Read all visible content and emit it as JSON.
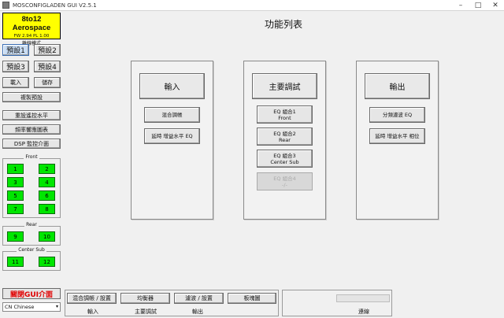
{
  "window": {
    "title": "MOSCONFIGLADEN GUI V2.5.1",
    "minimize": "–",
    "maximize": "□",
    "close": "✕"
  },
  "brand": {
    "name": "8to12 Aerospace",
    "fw": "FW 2.94   PL 1.00",
    "mode": "離線模式",
    "bg": "#ffff00"
  },
  "presets": [
    "預設1",
    "預設2",
    "預設3",
    "預設4"
  ],
  "left_buttons": {
    "import": "載入",
    "save": "儲存",
    "copy_preset": "複製預設",
    "input_level": "重設遙控水平",
    "freq_response": "頻率響應圖表",
    "dsp_monitor": "DSP 監控介面"
  },
  "groups": {
    "front": {
      "label": "Front",
      "channels": [
        "1",
        "2",
        "3",
        "4",
        "5",
        "6",
        "7",
        "8"
      ]
    },
    "rear": {
      "label": "Rear",
      "channels": [
        "9",
        "10"
      ]
    },
    "center_sub": {
      "label": "Center Sub",
      "channels": [
        "11",
        "12"
      ]
    }
  },
  "close_gui": "關閉GUI介面",
  "language": {
    "value": "CN Chinese",
    "arrow": "▾"
  },
  "main": {
    "title": "功能列表",
    "columns": [
      {
        "header": "輸入",
        "buttons": [
          "混合調帳",
          "延時 增益水平 EQ"
        ]
      },
      {
        "header": "主要調試",
        "buttons": [
          "EQ 組合1\nFront",
          "EQ 組合2\nRear",
          "EQ 組合3\nCenter Sub",
          "EQ 組合4\n-/-"
        ]
      },
      {
        "header": "輸出",
        "buttons": [
          "分頻濾波 EQ",
          "延時 增益水平 相位"
        ]
      }
    ]
  },
  "bottom": {
    "buttons": [
      "混合調帳 / 設置",
      "均衡器",
      "濾波 / 設置",
      "板塊圖"
    ],
    "labels": [
      "輸入",
      "主要調試",
      "輸出"
    ],
    "status_label": "連線"
  },
  "colors": {
    "channel_green": "#00e600",
    "close_red": "#e00000",
    "active_preset": "#c9ddf4"
  }
}
